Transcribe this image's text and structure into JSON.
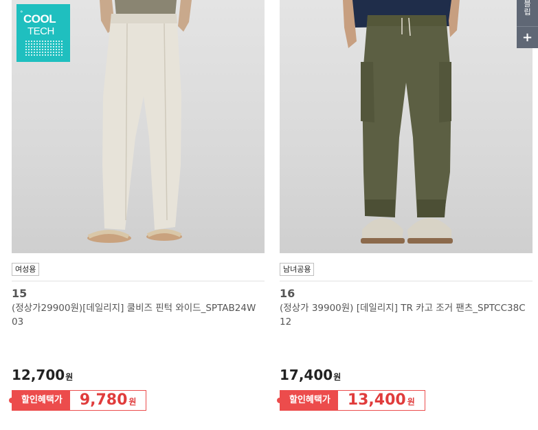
{
  "products": [
    {
      "badge_line1": "COOL",
      "badge_line2": "TECH",
      "tag": "여성용",
      "number": "15",
      "name": "(정상가29900원)[데일리지] 쿨비즈 핀턱 와이드_SPTAB24W03",
      "price": "12,700",
      "price_unit": "원",
      "discount_label": "할인혜택가",
      "discount_price": "9,780",
      "discount_unit": "원",
      "image_icon": "beige-wide-pants-photo"
    },
    {
      "tag": "남녀공용",
      "number": "16",
      "name": "(정상가 39900원) [데일리지] TR 카고 조거 팬츠_SPTCC38C12",
      "price": "17,400",
      "price_unit": "원",
      "discount_label": "할인혜택가",
      "discount_price": "13,400",
      "discount_unit": "원",
      "image_icon": "olive-cargo-jogger-photo"
    }
  ],
  "side_panel": {
    "label_chars": [
      "블",
      "립"
    ],
    "add_symbol": "+"
  },
  "colors": {
    "discount_red": "#ec4c4c",
    "badge_teal": "#1fbfbf",
    "side_panel_bg": "#5f6775"
  }
}
